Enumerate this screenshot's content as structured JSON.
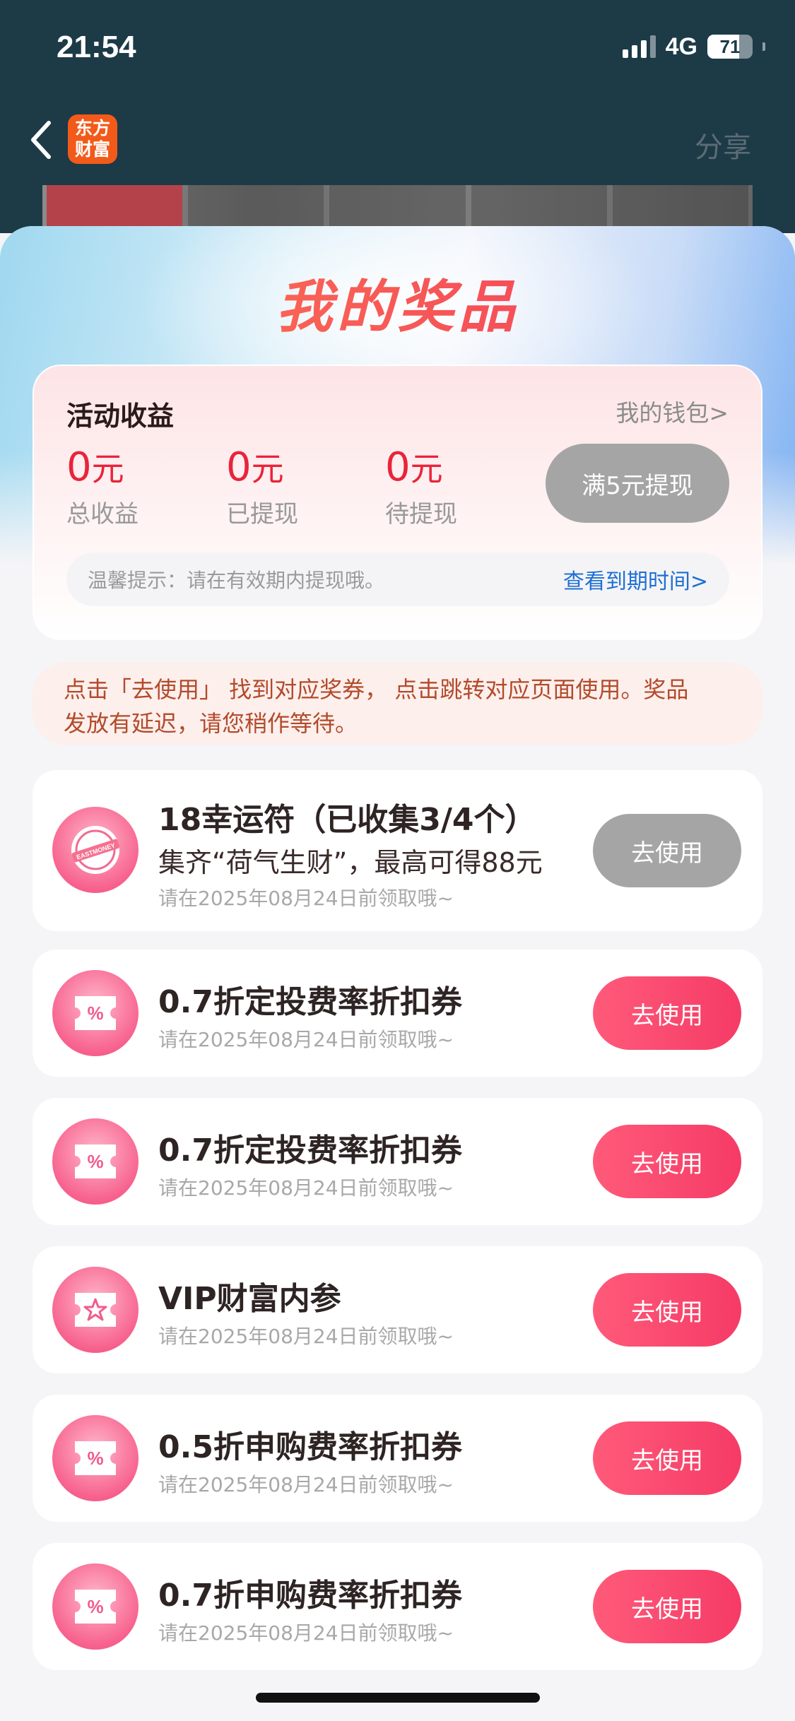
{
  "status_bar": {
    "time": "21:54",
    "network": "4G",
    "battery": "71",
    "battery_level": 0.71
  },
  "nav": {
    "logo_line1": "东方",
    "logo_line2": "财富",
    "share": "分享"
  },
  "sheet": {
    "title": "我的奖品"
  },
  "earnings": {
    "heading": "活动收益",
    "wallet_link": "我的钱包>",
    "stats": [
      {
        "value": "0",
        "unit": "元",
        "label": "总收益"
      },
      {
        "value": "0",
        "unit": "元",
        "label": "已提现"
      },
      {
        "value": "0",
        "unit": "元",
        "label": "待提现"
      }
    ],
    "withdraw_button": "满5元提现",
    "tip": "温馨提示：请在有效期内提现哦。",
    "tip_link": "查看到期时间>"
  },
  "notice": {
    "line1": "点击「去使用」 找到对应奖券， 点击跳转对应页面使用。奖品",
    "line2": "发放有延迟，请您稍作等待。"
  },
  "prizes": [
    {
      "title": "18幸运符（已收集3/4个）",
      "subtitle": "集齐“荷气生财”，最高可得88元",
      "date": "请在2025年08月24日前领取哦~",
      "button": "去使用",
      "icon": "eastmoney-badge-icon",
      "enabled": false
    },
    {
      "title": "0.7折定投费率折扣券",
      "date": "请在2025年08月24日前领取哦~",
      "button": "去使用",
      "icon": "percent-coupon-icon",
      "enabled": true
    },
    {
      "title": "0.7折定投费率折扣券",
      "date": "请在2025年08月24日前领取哦~",
      "button": "去使用",
      "icon": "percent-coupon-icon",
      "enabled": true
    },
    {
      "title": "VIP财富内参",
      "date": "请在2025年08月24日前领取哦~",
      "button": "去使用",
      "icon": "star-ticket-icon",
      "enabled": true
    },
    {
      "title": "0.5折申购费率折扣券",
      "date": "请在2025年08月24日前领取哦~",
      "button": "去使用",
      "icon": "percent-coupon-icon",
      "enabled": true
    },
    {
      "title": "0.7折申购费率折扣券",
      "date": "请在2025年08月24日前领取哦~",
      "button": "去使用",
      "icon": "percent-coupon-icon",
      "enabled": true
    }
  ],
  "colors": {
    "accent_red": "#e8243b",
    "button_pink": "#f53b66",
    "disabled_gray": "#a5a5a5",
    "link_blue": "#1e6fd4",
    "header_dark": "#1d3a47"
  }
}
